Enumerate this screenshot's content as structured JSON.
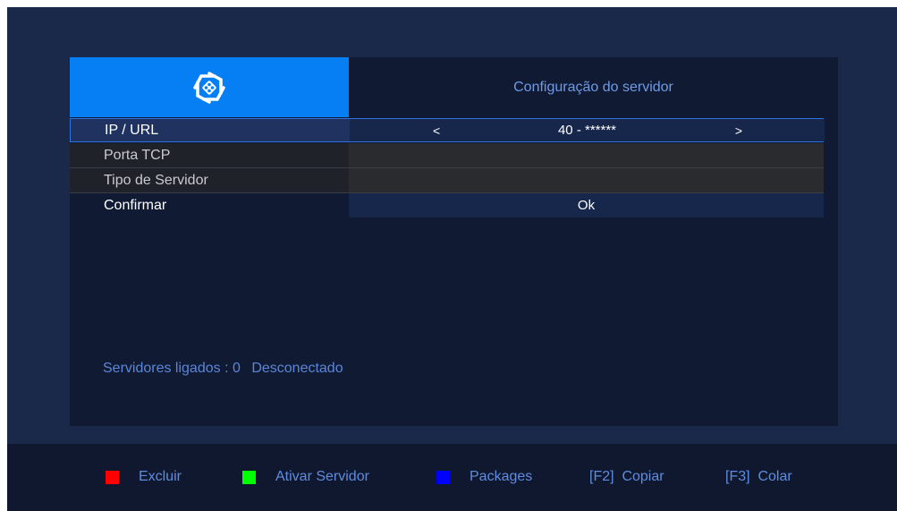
{
  "header": {
    "logo_icon": "gear-hexagon-logo-icon",
    "title": "Configuração do servidor"
  },
  "menu": {
    "ip_url": {
      "label": "IP / URL",
      "value": "40 - ******",
      "left_arrow": "<",
      "right_arrow": ">"
    },
    "porta_tcp": {
      "label": "Porta TCP",
      "value": ""
    },
    "tipo_servidor": {
      "label": "Tipo de Servidor",
      "value": ""
    },
    "confirmar": {
      "label": "Confirmar",
      "value": "Ok"
    }
  },
  "status": {
    "servers_label": "Servidores ligados : 0",
    "connection": "Desconectado"
  },
  "footer": {
    "red": {
      "label": "Excluir",
      "color": "#ff0000"
    },
    "green": {
      "label": "Ativar Servidor",
      "color": "#00ff00"
    },
    "blue": {
      "label": "Packages",
      "color": "#0000ff"
    },
    "f2": {
      "label": "[F2]  Copiar"
    },
    "f3": {
      "label": "[F3]  Colar"
    }
  },
  "colors": {
    "screen_bg": "#1a2849",
    "panel_bg": "#101a33",
    "accent_blue": "#067ff4",
    "text_blue": "#5f8ce0"
  }
}
